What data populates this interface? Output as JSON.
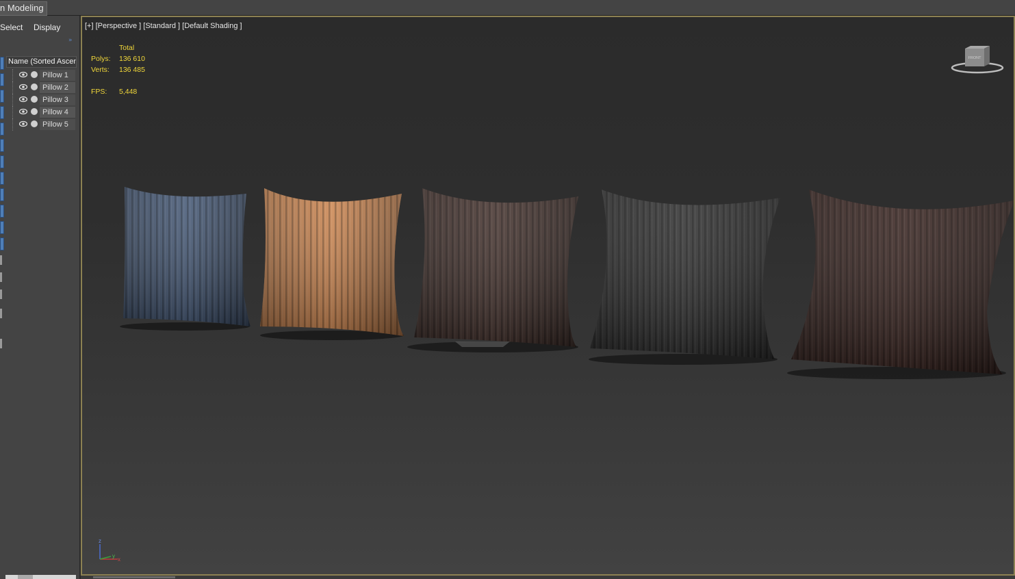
{
  "ribbon": {
    "tab_label": "n Modeling"
  },
  "explorer": {
    "menu": [
      "Select",
      "Display"
    ],
    "more_glyph": "»",
    "column_header": "Name (Sorted Ascending)",
    "items": [
      {
        "label": "Pillow 1"
      },
      {
        "label": "Pillow 2"
      },
      {
        "label": "Pillow 3"
      },
      {
        "label": "Pillow 4"
      },
      {
        "label": "Pillow 5"
      }
    ]
  },
  "viewport": {
    "label": "[+] [Perspective ] [Standard ] [Default Shading ]",
    "stats": {
      "total_header": "Total",
      "polys_label": "Polys:",
      "polys_value": "136 610",
      "verts_label": "Verts:",
      "verts_value": "136 485",
      "fps_label": "FPS:",
      "fps_value": "5,448"
    },
    "viewcube_label": "FRONT",
    "axis": {
      "x": "x",
      "y": "y",
      "z": "z"
    },
    "pillow_colors": [
      "#4a5d7a",
      "#d08a55",
      "#4a3833",
      "#363636",
      "#3e2a26"
    ],
    "stats_color": "#f2d83a",
    "border_color": "#8c8152"
  }
}
